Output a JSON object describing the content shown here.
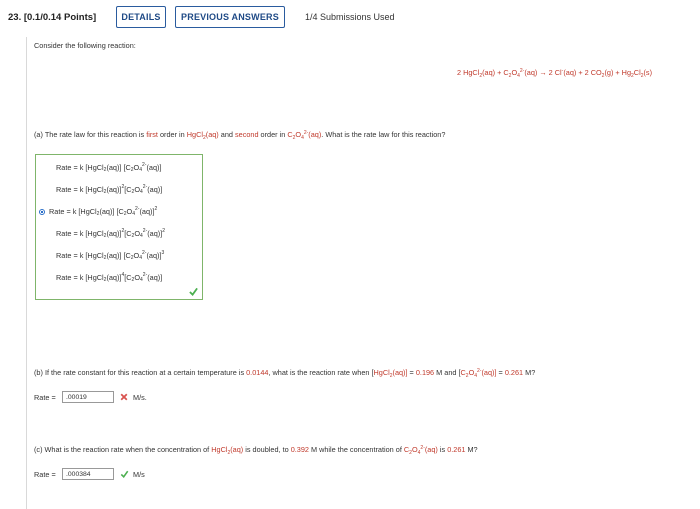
{
  "header": {
    "question_label": "23. [0.1/0.14 Points]",
    "details_label": "DETAILS",
    "previous_answers_label": "PREVIOUS ANSWERS",
    "submissions": "1/4 Submissions Used"
  },
  "question": {
    "intro": "Consider the following reaction:",
    "equation": {
      "p1": "2 HgCl",
      "s1": "2",
      "p2": "(aq) + C",
      "s2": "2",
      "p3": "O",
      "s3": "4",
      "sup3": "2-",
      "p4": "(aq) → 2 Cl",
      "sup4": "-",
      "p5": "(aq) + 2 CO",
      "s5": "2",
      "p6": "(g) + Hg",
      "s6": "2",
      "p7": "Cl",
      "s7": "2",
      "p8": "(s)"
    }
  },
  "part_a": {
    "t1": "(a) The rate law for this reaction is ",
    "first": "first",
    "t2": " order in ",
    "hgcl": "HgCl",
    "hgcl_sub": "2",
    "hgcl_aq": "(aq)",
    "t3": " and ",
    "second": "second",
    "t4": " order in ",
    "c2o4_a": "C",
    "c2o4_s1": "2",
    "c2o4_b": "O",
    "c2o4_s2": "4",
    "c2o4_sup": "2-",
    "c2o4_aq": "(aq)",
    "t5": ". What is the rate law for this reaction?",
    "choices": [
      {
        "a": "Rate = k [HgCl",
        "s1": "2",
        "b": "(aq)] [C",
        "s2": "2",
        "c": "O",
        "s3": "4",
        "sup": "2-",
        "d": "(aq)]",
        "e": "",
        "f": ""
      },
      {
        "a": "Rate = k [HgCl",
        "s1": "2",
        "b": "(aq)]",
        "s2": "2",
        "c": " [C",
        "s3": "2",
        "sup": "",
        "d": "O",
        "e": "4",
        "f": "2-",
        "g": "(aq)]"
      },
      {
        "a": "Rate = k [HgCl",
        "s1": "2",
        "b": "(aq)] [C",
        "s2": "2",
        "c": "O",
        "s3": "4",
        "sup": "2-",
        "d": "(aq)]",
        "e": "2",
        "f": ""
      },
      {
        "a": "Rate = k [HgCl",
        "s1": "2",
        "b": "(aq)]",
        "s2": "2",
        "c": " [C",
        "s3": "2",
        "d": "O",
        "e": "4",
        "f": "2-",
        "g": "(aq)]",
        "h": "2"
      },
      {
        "a": "Rate = k [HgCl",
        "s1": "2",
        "b": "(aq)] [C",
        "s2": "2",
        "c": "O",
        "s3": "4",
        "sup": "2-",
        "d": "(aq)]",
        "e": "3",
        "f": ""
      },
      {
        "a": "Rate = k [HgCl",
        "s1": "2",
        "b": "(aq)]",
        "s2": "4",
        "c": " [C",
        "s3": "2",
        "d": "O",
        "e": "4",
        "f": "2-",
        "g": "(aq)]"
      }
    ],
    "selected_index": 2
  },
  "part_b": {
    "t1": "(b) If the rate constant for this reaction at a certain temperature is ",
    "k": "0.0144",
    "t2": ", what is the reaction rate when [",
    "hgcl": "HgCl",
    "hgcl_sub": "2",
    "hgcl_aq": "(aq)]",
    "t3": " = ",
    "conc1": "0.196",
    "t4": " M and [",
    "c2o4_a": "C",
    "c2o4_s1": "2",
    "c2o4_b": "O",
    "c2o4_s2": "4",
    "c2o4_sup": "2-",
    "c2o4_aq": "(aq)]",
    "t5": " = ",
    "conc2": "0.261",
    "t6": " M?",
    "rate_label": "Rate =",
    "answer_value": ".00019",
    "unit": "M/s."
  },
  "part_c": {
    "t1": "(c) What is the reaction rate when the concentration of ",
    "hgcl": "HgCl",
    "hgcl_sub": "2",
    "hgcl_aq": "(aq)",
    "t2": " is doubled, to ",
    "conc1": "0.392",
    "t3": " M while the concentration of ",
    "c2o4_a": "C",
    "c2o4_s1": "2",
    "c2o4_b": "O",
    "c2o4_s2": "4",
    "c2o4_sup": "2-",
    "c2o4_aq": "(aq)",
    "t4": " is ",
    "conc2": "0.261",
    "t5": " M?",
    "rate_label": "Rate =",
    "answer_value": ".000384",
    "unit": "M/s"
  },
  "colors": {
    "highlight": "#c0392b",
    "correct": "#4caf50",
    "incorrect": "#d9534f",
    "button_border": "#2a5b9e"
  }
}
